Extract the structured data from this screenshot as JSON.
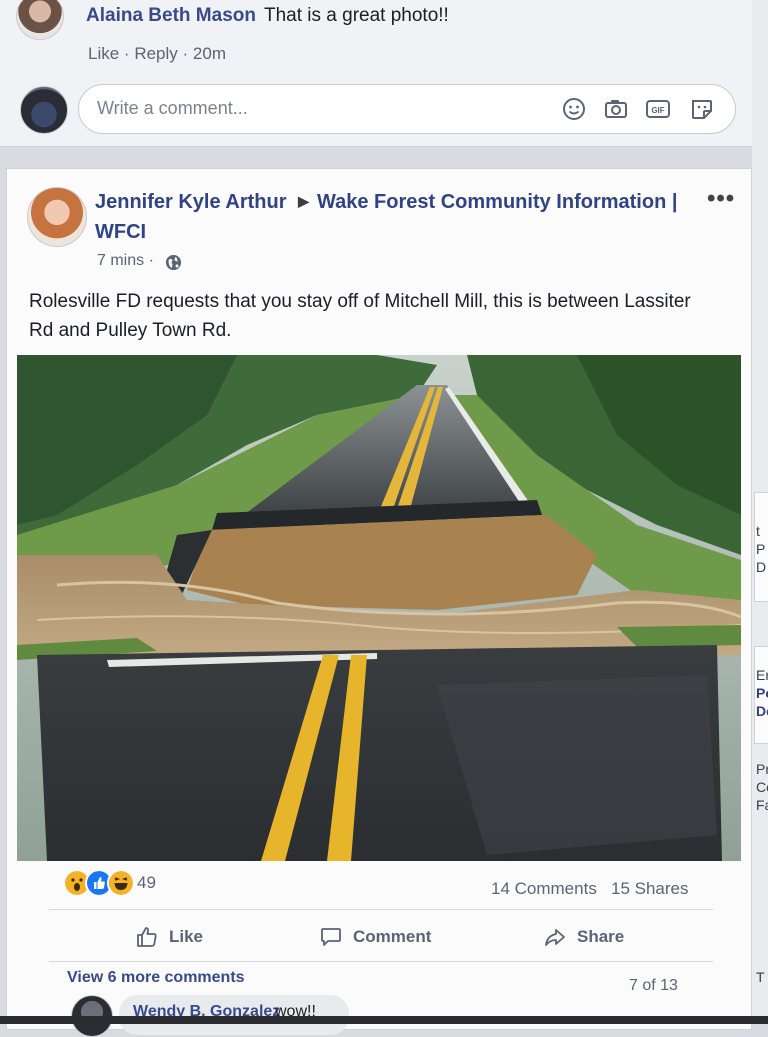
{
  "top_comment": {
    "author": "Alaina Beth Mason",
    "text": "That is a great photo!!",
    "actions": {
      "like": "Like",
      "reply": "Reply",
      "time": "20m"
    }
  },
  "composer": {
    "placeholder": "Write a comment...",
    "tools": [
      "emoji-icon",
      "camera-icon",
      "gif-icon",
      "sticker-icon"
    ]
  },
  "post": {
    "author": "Jennifer Kyle Arthur",
    "group_line1": "Wake Forest Community Information |",
    "group_line2": "WFCI",
    "more": "•••",
    "time": "7 mins",
    "body": "Rolesville FD requests that you stay off of Mitchell Mill, this is between Lassiter Rd and Pulley Town Rd.",
    "photo_icon": "collapsed-road-photo",
    "reaction_count": "49",
    "reaction_icons": [
      "wow-icon",
      "like-icon",
      "haha-icon"
    ],
    "comments_count": "14 Comments",
    "shares_count": "15 Shares",
    "actions": {
      "like": "Like",
      "comment": "Comment",
      "share": "Share"
    },
    "view_more": "View 6 more comments",
    "pager": "7 of 13",
    "reply": {
      "author": "Wendy B. Gonzalez",
      "text": "wow!!"
    }
  },
  "right_rail": {
    "lines_a": [
      "t",
      "P",
      "D"
    ],
    "lines_b": [
      "Er",
      "Po",
      "De"
    ],
    "lines_c": [
      "Pri",
      "Co",
      "Fa"
    ],
    "line_d": "T"
  },
  "colors": {
    "link_blue": "#2f4386",
    "meta_gray": "#5b6475",
    "wow": "#f7b125",
    "like": "#1877f2",
    "haha": "#f7b125"
  }
}
